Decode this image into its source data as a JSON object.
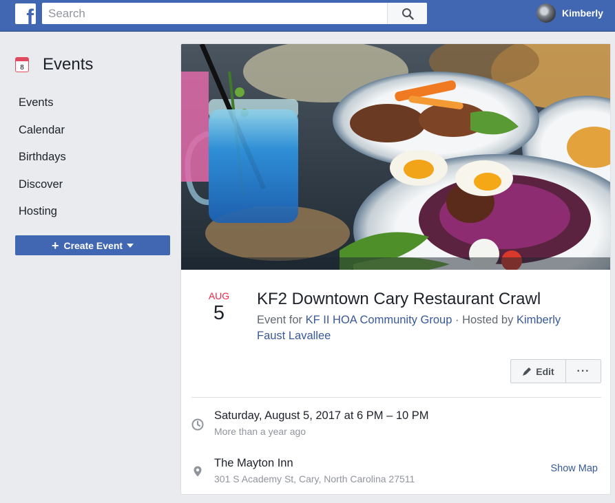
{
  "topbar": {
    "logo_letter": "f",
    "search_placeholder": "Search",
    "profile_name": "Kimberly"
  },
  "sidebar": {
    "calendar_day": "8",
    "title": "Events",
    "items": [
      {
        "label": "Events"
      },
      {
        "label": "Calendar"
      },
      {
        "label": "Birthdays"
      },
      {
        "label": "Discover"
      },
      {
        "label": "Hosting"
      }
    ],
    "create_button": "Create Event"
  },
  "event": {
    "month": "AUG",
    "day": "5",
    "title": "KF2 Downtown Cary Restaurant Crawl",
    "event_for_prefix": "Event for",
    "group_name": "KF II HOA Community Group",
    "separator": "·",
    "hosted_by_prefix": "Hosted by",
    "host_name": "Kimberly Faust Lavallee",
    "edit_label": "Edit",
    "more_label": "···",
    "datetime": "Saturday, August 5, 2017 at 6 PM – 10 PM",
    "relative_time": "More than a year ago",
    "venue": "The Mayton Inn",
    "address": "301 S Academy St, Cary, North Carolina 27511",
    "show_map": "Show Map"
  },
  "colors": {
    "brand": "#4267b2",
    "link": "#385898",
    "month_red": "#f02849"
  }
}
